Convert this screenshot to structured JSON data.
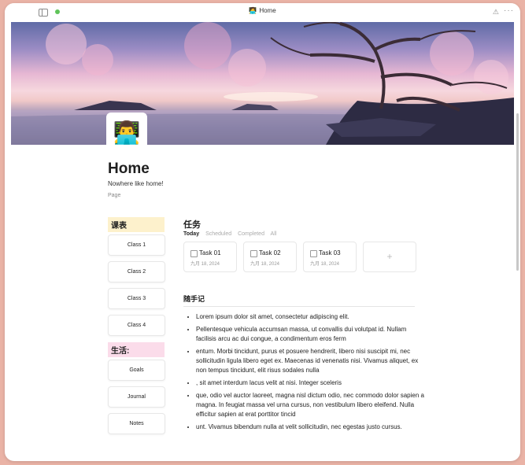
{
  "titlebar": {
    "emoji": "🧑‍💻",
    "title": "Home",
    "more": "···"
  },
  "page": {
    "avatar_emoji": "👨‍💻",
    "title": "Home",
    "subtitle": "Nowhere like home!",
    "tag": "Page"
  },
  "sidebar": {
    "section1_title": "课表",
    "classes": [
      "Class 1",
      "Class 2",
      "Class 3",
      "Class 4"
    ],
    "section2_title": "生活:",
    "life": [
      "Goals",
      "Journal",
      "Notes"
    ]
  },
  "tasks": {
    "title": "任务",
    "tabs": [
      "Today",
      "Scheduled",
      "Completed",
      "All"
    ],
    "active_tab": "Today",
    "items": [
      {
        "name": "Task 01",
        "date": "九月 18, 2024"
      },
      {
        "name": "Task 02",
        "date": "九月 18, 2024"
      },
      {
        "name": "Task 03",
        "date": "九月 18, 2024"
      }
    ],
    "add_label": "+"
  },
  "notes": {
    "title": "随手记",
    "items": [
      "Lorem ipsum dolor sit amet, consectetur adipiscing elit.",
      "Pellentesque vehicula accumsan massa, ut convallis dui volutpat id. Nullam facilisis arcu ac dui congue, a condimentum eros ferm",
      "entum. Morbi tincidunt, purus et posuere hendrerit, libero nisi suscipit mi, nec sollicitudin ligula libero eget ex. Maecenas id venenatis nisi. Vivamus aliquet, ex non tempus tincidunt, elit risus sodales nulla",
      ", sit amet interdum lacus velit at nisi. Integer sceleris",
      "que, odio vel auctor laoreet, magna nisl dictum odio, nec commodo dolor sapien a magna. In feugiat massa vel urna cursus, non vestibulum libero eleifend. Nulla efficitur sapien at erat porttitor tincid",
      "unt. Vivamus bibendum nulla at velit sollicitudin, nec egestas justo cursus."
    ]
  }
}
